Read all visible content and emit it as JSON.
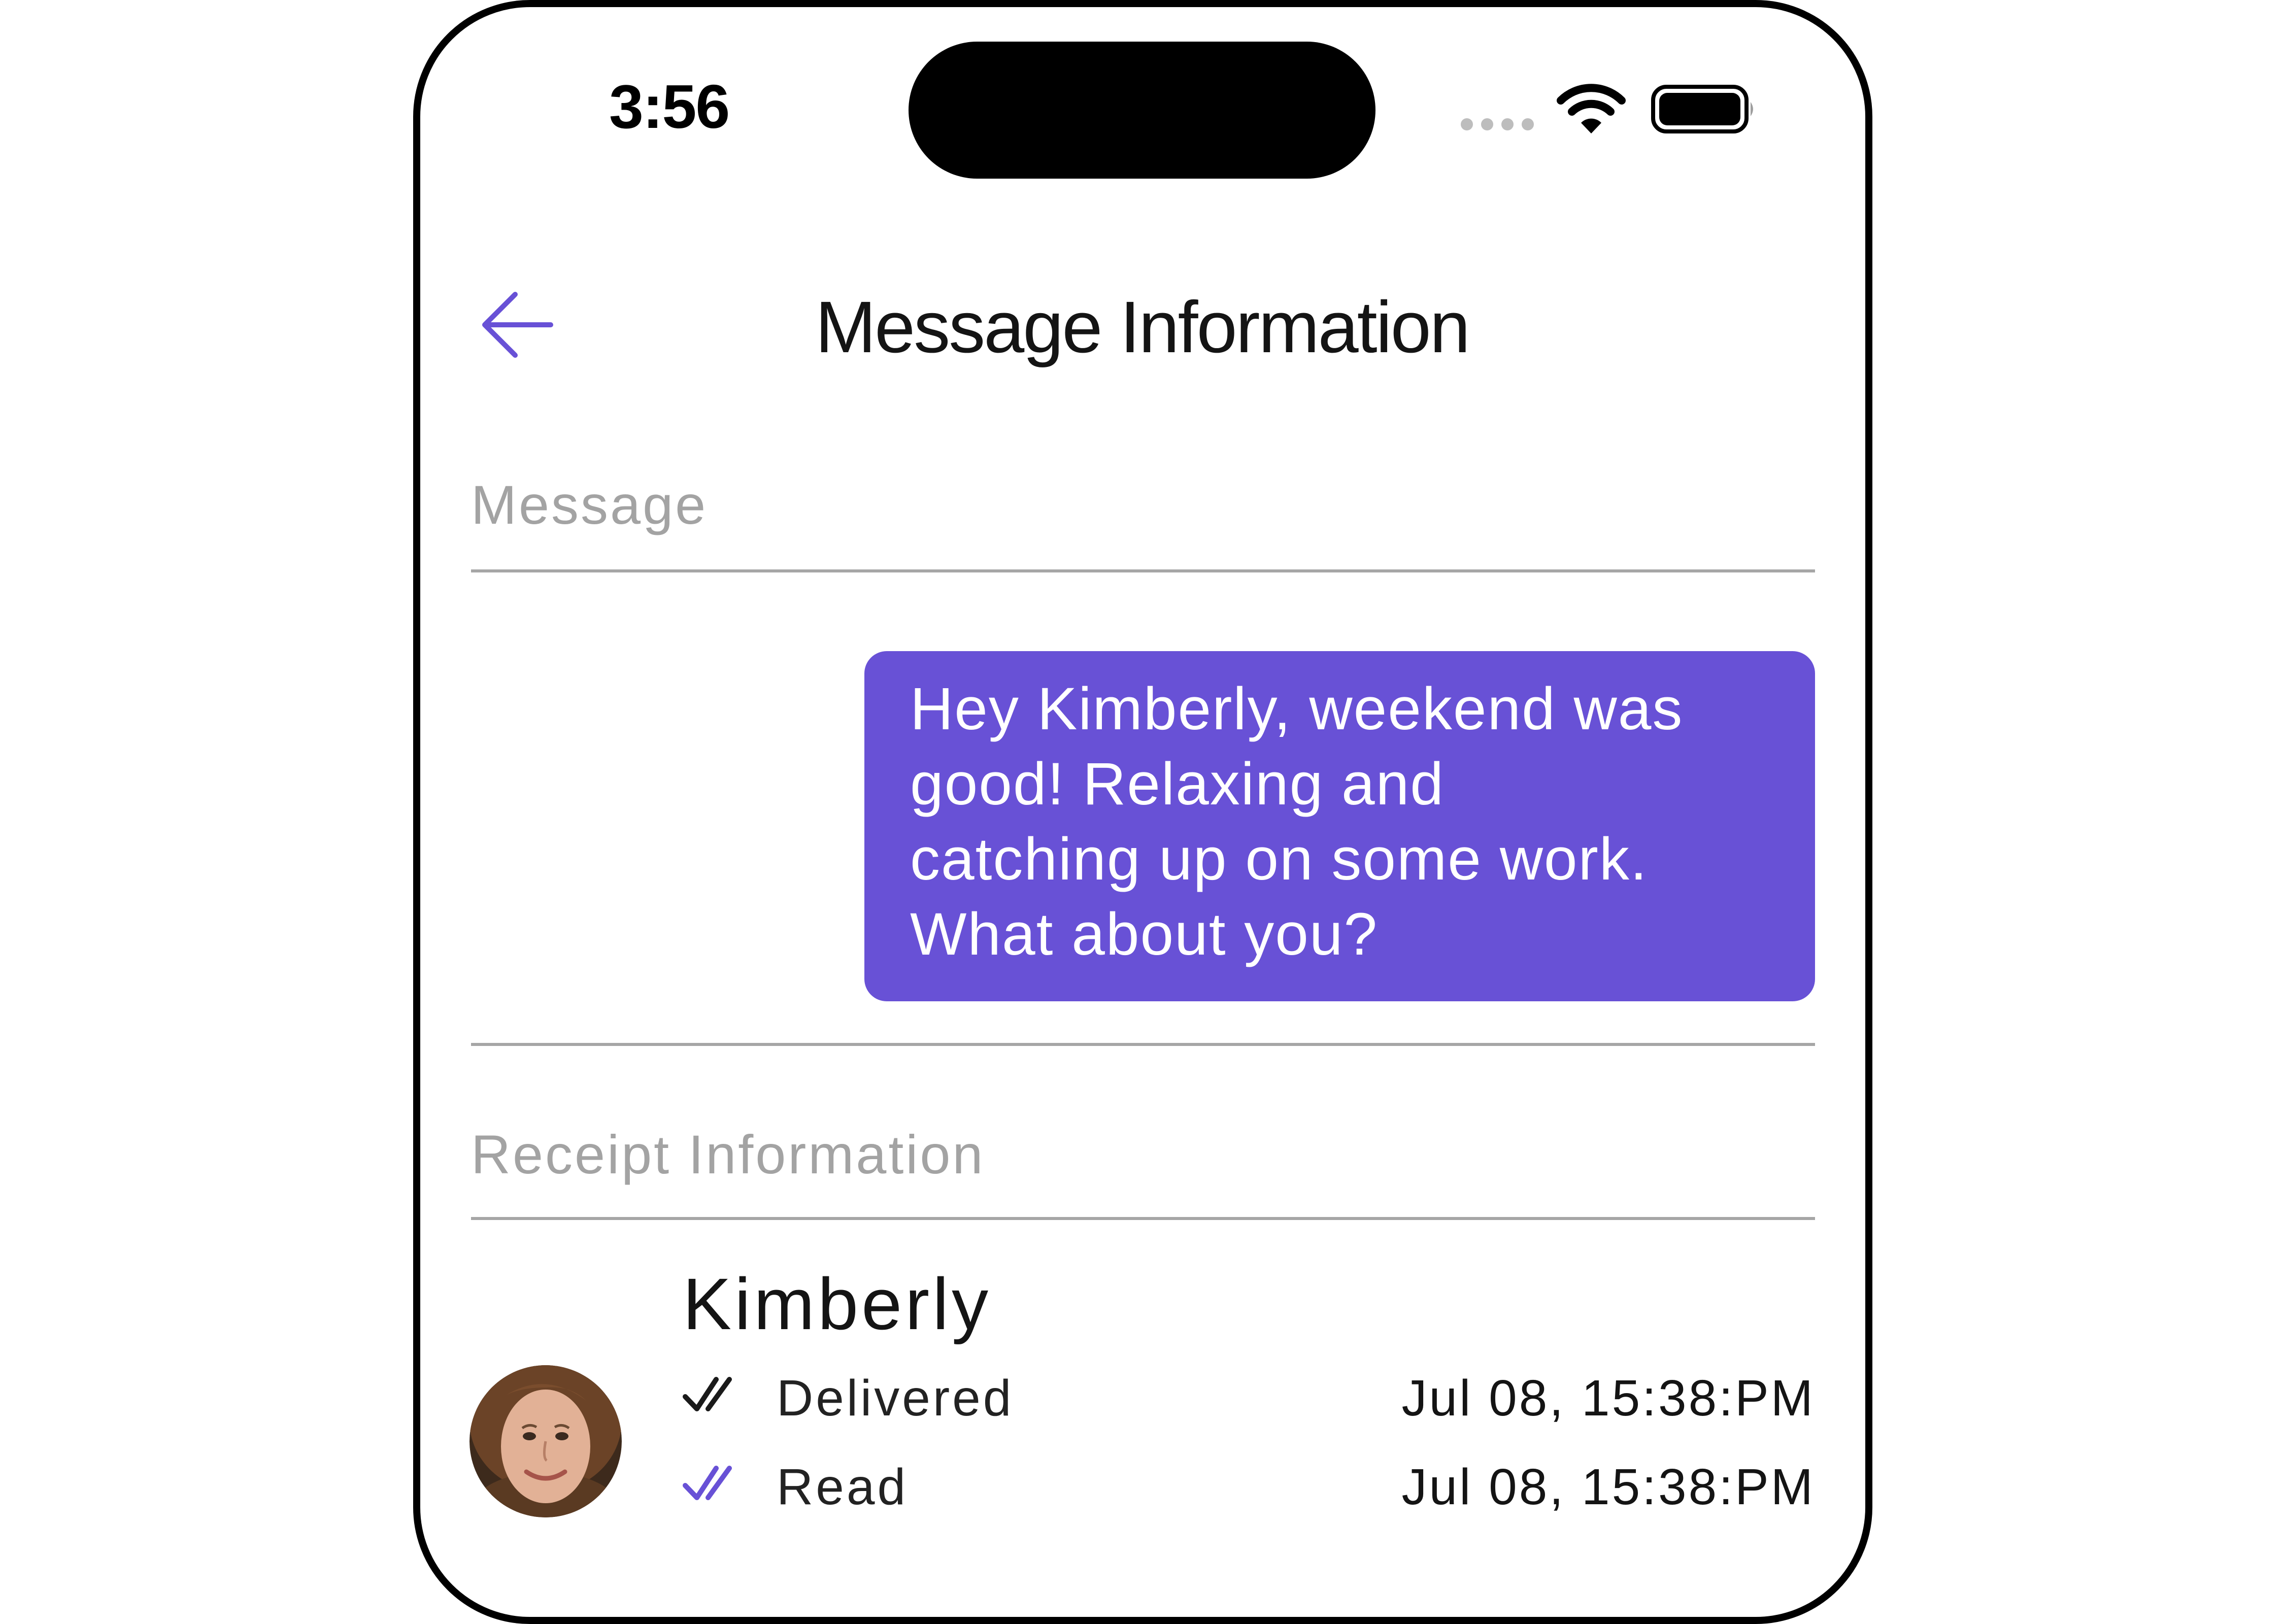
{
  "status_bar": {
    "time": "3:56",
    "signal_icon": "cellular-signal-dots",
    "wifi_icon": "wifi-icon",
    "battery_icon": "battery-full-icon"
  },
  "header": {
    "back_icon": "arrow-left-icon",
    "title": "Message Information"
  },
  "message_section": {
    "label": "Message",
    "bubble_text": "Hey Kimberly, weekend was\ngood!  Relaxing and\ncatching up on some work.\nWhat about you?"
  },
  "receipt_section": {
    "label": "Receipt Information",
    "recipient": {
      "name": "Kimberly",
      "statuses": [
        {
          "label": "Delivered",
          "time": "Jul 08, 15:38:PM",
          "icon": "double-check-icon"
        },
        {
          "label": "Read",
          "time": "Jul 08, 15:38:PM",
          "icon": "double-check-icon"
        }
      ]
    }
  },
  "colors": {
    "accent": "#6851d6",
    "delivered_check": "#1a1a1a",
    "read_check": "#6851d6",
    "section_label": "#a3a3a3",
    "divider": "#a6a6a6"
  }
}
